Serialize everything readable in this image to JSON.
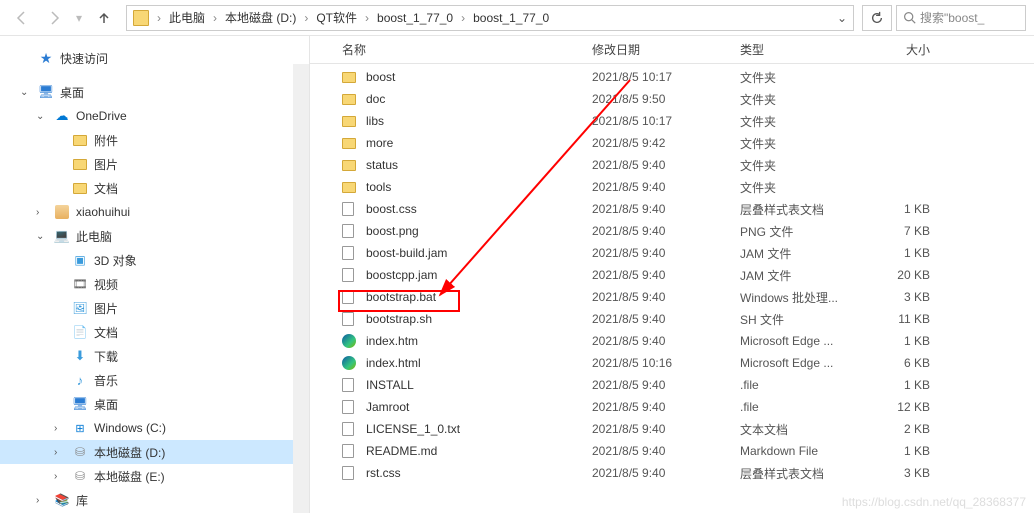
{
  "toolbar": {
    "breadcrumbs": [
      "此电脑",
      "本地磁盘 (D:)",
      "QT软件",
      "boost_1_77_0",
      "boost_1_77_0"
    ],
    "search_placeholder": "搜索\"boost_"
  },
  "sidebar": {
    "quick_access": "快速访问",
    "desktop": "桌面",
    "onedrive": "OneDrive",
    "attachments": "附件",
    "pictures": "图片",
    "documents": "文档",
    "user": "xiaohuihui",
    "this_pc": "此电脑",
    "3d_objects": "3D 对象",
    "videos": "视频",
    "pics2": "图片",
    "docs2": "文档",
    "downloads": "下载",
    "music": "音乐",
    "desktop2": "桌面",
    "win_c": "Windows (C:)",
    "disk_d": "本地磁盘 (D:)",
    "disk_e": "本地磁盘 (E:)",
    "lib": "库"
  },
  "columns": {
    "name": "名称",
    "date": "修改日期",
    "type": "类型",
    "size": "大小"
  },
  "files": [
    {
      "name": "boost",
      "date": "2021/8/5 10:17",
      "type": "文件夹",
      "size": "",
      "icon": "folder"
    },
    {
      "name": "doc",
      "date": "2021/8/5 9:50",
      "type": "文件夹",
      "size": "",
      "icon": "folder"
    },
    {
      "name": "libs",
      "date": "2021/8/5 10:17",
      "type": "文件夹",
      "size": "",
      "icon": "folder"
    },
    {
      "name": "more",
      "date": "2021/8/5 9:42",
      "type": "文件夹",
      "size": "",
      "icon": "folder"
    },
    {
      "name": "status",
      "date": "2021/8/5 9:40",
      "type": "文件夹",
      "size": "",
      "icon": "folder"
    },
    {
      "name": "tools",
      "date": "2021/8/5 9:40",
      "type": "文件夹",
      "size": "",
      "icon": "folder"
    },
    {
      "name": "boost.css",
      "date": "2021/8/5 9:40",
      "type": "层叠样式表文档",
      "size": "1 KB",
      "icon": "file"
    },
    {
      "name": "boost.png",
      "date": "2021/8/5 9:40",
      "type": "PNG 文件",
      "size": "7 KB",
      "icon": "file"
    },
    {
      "name": "boost-build.jam",
      "date": "2021/8/5 9:40",
      "type": "JAM 文件",
      "size": "1 KB",
      "icon": "file"
    },
    {
      "name": "boostcpp.jam",
      "date": "2021/8/5 9:40",
      "type": "JAM 文件",
      "size": "20 KB",
      "icon": "file"
    },
    {
      "name": "bootstrap.bat",
      "date": "2021/8/5 9:40",
      "type": "Windows 批处理...",
      "size": "3 KB",
      "icon": "file"
    },
    {
      "name": "bootstrap.sh",
      "date": "2021/8/5 9:40",
      "type": "SH 文件",
      "size": "11 KB",
      "icon": "file"
    },
    {
      "name": "index.htm",
      "date": "2021/8/5 9:40",
      "type": "Microsoft Edge ...",
      "size": "1 KB",
      "icon": "edge"
    },
    {
      "name": "index.html",
      "date": "2021/8/5 10:16",
      "type": "Microsoft Edge ...",
      "size": "6 KB",
      "icon": "edge"
    },
    {
      "name": "INSTALL",
      "date": "2021/8/5 9:40",
      "type": ".file",
      "size": "1 KB",
      "icon": "file"
    },
    {
      "name": "Jamroot",
      "date": "2021/8/5 9:40",
      "type": ".file",
      "size": "12 KB",
      "icon": "file"
    },
    {
      "name": "LICENSE_1_0.txt",
      "date": "2021/8/5 9:40",
      "type": "文本文档",
      "size": "2 KB",
      "icon": "file"
    },
    {
      "name": "README.md",
      "date": "2021/8/5 9:40",
      "type": "Markdown File",
      "size": "1 KB",
      "icon": "file"
    },
    {
      "name": "rst.css",
      "date": "2021/8/5 9:40",
      "type": "层叠样式表文档",
      "size": "3 KB",
      "icon": "file"
    }
  ],
  "watermark": "https://blog.csdn.net/qq_28368377"
}
